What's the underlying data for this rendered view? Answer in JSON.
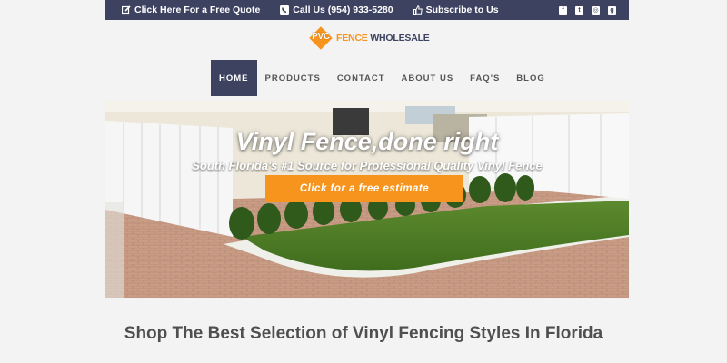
{
  "topbar": {
    "quote": "Click Here For a Free Quote",
    "phone": "Call Us (954) 933-5280",
    "subscribe": "Subscribe to Us",
    "social_icons": [
      "facebook-icon",
      "twitter-icon",
      "instagram-icon",
      "google-plus-icon"
    ],
    "bg_color": "#3d4261"
  },
  "logo": {
    "mark_text": "PVC",
    "name_part1": "FENCE",
    "name_part2": "WHOLESALE",
    "accent_color": "#f7941d"
  },
  "nav": {
    "items": [
      "HOME",
      "PRODUCTS",
      "CONTACT",
      "ABOUT US",
      "FAQ'S",
      "BLOG"
    ],
    "active": "HOME"
  },
  "hero": {
    "title": "Vinyl Fence,done right",
    "subtitle": "South Florida's #1 Source for Professional Quality Vinyl Fence",
    "cta": "Click for a free estimate"
  },
  "main": {
    "heading": "Shop The Best Selection of Vinyl Fencing Styles In Florida"
  }
}
